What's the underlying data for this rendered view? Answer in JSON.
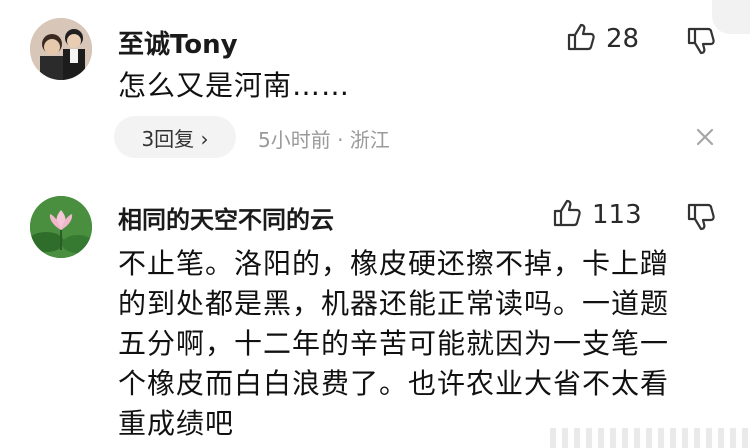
{
  "comments": [
    {
      "user": "至诚Tony",
      "likes": "28",
      "text_lines": [
        "怎么又是河南……"
      ],
      "reply_button": "3回复 ›",
      "meta": "5小时前 · 浙江"
    },
    {
      "user": "相同的天空不同的云",
      "likes": "113",
      "text_lines": [
        "不止笔。洛阳的，橡皮硬还擦不掉，卡上蹭",
        "的到处都是黑，机器还能正常读吗。一道题",
        "五分啊，十二年的辛苦可能就因为一支笔一",
        "个橡皮而白白浪费了。也许农业大省不太看",
        "重成绩吧"
      ]
    }
  ],
  "icons": {
    "like": "thumb-up-icon",
    "dislike": "thumb-down-icon",
    "close": "close-icon"
  }
}
